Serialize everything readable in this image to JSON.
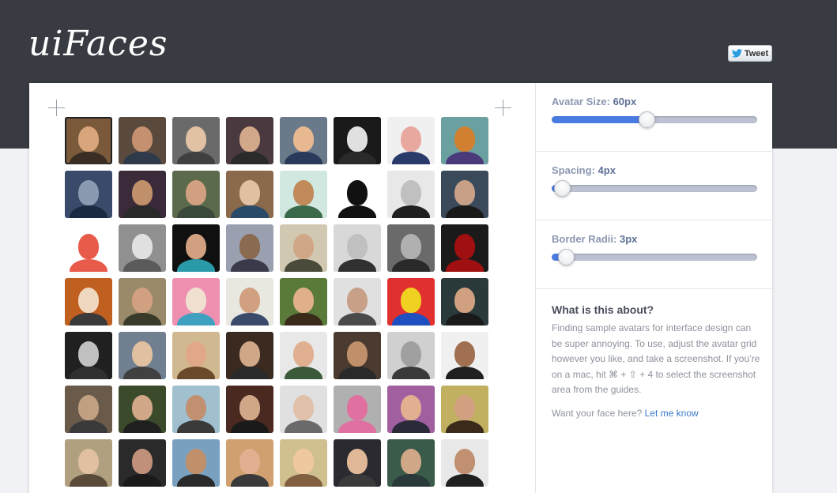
{
  "header": {
    "logo": "uiFaces",
    "tweet_label": "Tweet",
    "background_color": "#393b43"
  },
  "controls": [
    {
      "label": "Avatar Size:",
      "value": "60px",
      "level": 0.46
    },
    {
      "label": "Spacing:",
      "value": "4px",
      "level": 0.05
    },
    {
      "label": "Border Radii:",
      "value": "3px",
      "level": 0.07
    }
  ],
  "about": {
    "title": "What is this about?",
    "body": "Finding sample avatars for interface design can be super annoying. To use, adjust the avatar grid however you like, and take a screenshot. If you’re on a mac, hit ⌘ + ⇧ + 4 to select the screenshot area from the guides.",
    "cta_text": "Want your face here?",
    "cta_link": "Let me know"
  },
  "avatars": [
    [
      "#7a5a3a",
      "#d9a57c",
      "#3a2e24"
    ],
    [
      "#5a4a3e",
      "#c49070",
      "#2e3a4a"
    ],
    [
      "#6a6a6a",
      "#e2c2a4",
      "#404040"
    ],
    [
      "#4a3a40",
      "#d2a88a",
      "#2a2a2a"
    ],
    [
      "#6a7a8a",
      "#e8b890",
      "#2a3a5a"
    ],
    [
      "#1a1a1a",
      "#e0e0e0",
      "#2a2a2a"
    ],
    [
      "#f0f0f0",
      "#e8a8a0",
      "#2a3a6a"
    ],
    [
      "#6aa0a0",
      "#d08030",
      "#4a3a7a"
    ],
    [
      "#3a4a6a",
      "#8a9ab0",
      "#1a2a40"
    ],
    [
      "#3a2a3a",
      "#c0906a",
      "#2a2a2a"
    ],
    [
      "#5a6a4a",
      "#d0a080",
      "#3a4a3a"
    ],
    [
      "#8a6a4a",
      "#e0c0a0",
      "#2a4a6a"
    ],
    [
      "#d0e8e0",
      "#c08a5a",
      "#3a6a4a"
    ],
    [
      "#ffffff",
      "#111111",
      "#111111"
    ],
    [
      "#e8e8e8",
      "#c0c0c0",
      "#202020"
    ],
    [
      "#3a4a5a",
      "#c8a088",
      "#1a1a1a"
    ],
    [
      "#ffffff",
      "#e85a4a",
      "#e85a4a"
    ],
    [
      "#909090",
      "#e0e0e0",
      "#5a5a5a"
    ],
    [
      "#101010",
      "#d0a080",
      "#2a9aa8"
    ],
    [
      "#9aa0b0",
      "#8a6a50",
      "#3a3a4a"
    ],
    [
      "#d0c8b0",
      "#d0a888",
      "#4a4a3a"
    ],
    [
      "#d8d8d8",
      "#c0c0c0",
      "#303030"
    ],
    [
      "#6a6a6a",
      "#b0b0b0",
      "#2a2a2a"
    ],
    [
      "#1a1a1a",
      "#a01010",
      "#a01010"
    ],
    [
      "#c06020",
      "#f0d8c0",
      "#3a3a3a"
    ],
    [
      "#9a8a6a",
      "#d0a080",
      "#3a3a2a"
    ],
    [
      "#f090b0",
      "#f0e0d0",
      "#40a0c0"
    ],
    [
      "#e8e8e0",
      "#d0a080",
      "#3a4a6a"
    ],
    [
      "#5a7a3a",
      "#e0b088",
      "#3a2a1a"
    ],
    [
      "#e0e0e0",
      "#c8a088",
      "#4a4a4a"
    ],
    [
      "#e03030",
      "#f0d020",
      "#2050c0"
    ],
    [
      "#2a3a3a",
      "#d0a080",
      "#1a1a1a"
    ],
    [
      "#202020",
      "#c0c0c0",
      "#303030"
    ],
    [
      "#708090",
      "#e0c0a0",
      "#404040"
    ],
    [
      "#d0b890",
      "#e0a888",
      "#6a4a2a"
    ],
    [
      "#3a2a20",
      "#d0a888",
      "#2a2a2a"
    ],
    [
      "#e8e8e8",
      "#e0b090",
      "#3a5a3a"
    ],
    [
      "#4a3a30",
      "#c0906a",
      "#2a2a2a"
    ],
    [
      "#d0d0d0",
      "#a0a0a0",
      "#3a3a3a"
    ],
    [
      "#f0f0f0",
      "#a07050",
      "#202020"
    ],
    [
      "#6a5a4a",
      "#c0a080",
      "#3a3a3a"
    ],
    [
      "#3a4a2a",
      "#d0a888",
      "#202020"
    ],
    [
      "#a0c0d0",
      "#c09070",
      "#3a3a3a"
    ],
    [
      "#4a2a20",
      "#d0a888",
      "#1a1a1a"
    ],
    [
      "#e0e0e0",
      "#e0c0a8",
      "#6a6a6a"
    ],
    [
      "#b0b0b0",
      "#e070a0",
      "#e070a0"
    ],
    [
      "#a060a0",
      "#e0b090",
      "#2a2a3a"
    ],
    [
      "#c0b060",
      "#d0a080",
      "#3a2a1a"
    ],
    [
      "#b0a080",
      "#e0c0a0",
      "#5a4a3a"
    ],
    [
      "#2a2a2a",
      "#c0907a",
      "#1a1a1a"
    ],
    [
      "#7aa0c0",
      "#c0906a",
      "#2a2a2a"
    ],
    [
      "#d0a070",
      "#e0b090",
      "#3a3a3a"
    ],
    [
      "#d0c090",
      "#f0c8a0",
      "#806040"
    ],
    [
      "#2a2a30",
      "#e0b898",
      "#3a3a3a"
    ],
    [
      "#3a5a4a",
      "#d0a888",
      "#2a3a3a"
    ],
    [
      "#e8e8e8",
      "#c09070",
      "#202020"
    ]
  ]
}
